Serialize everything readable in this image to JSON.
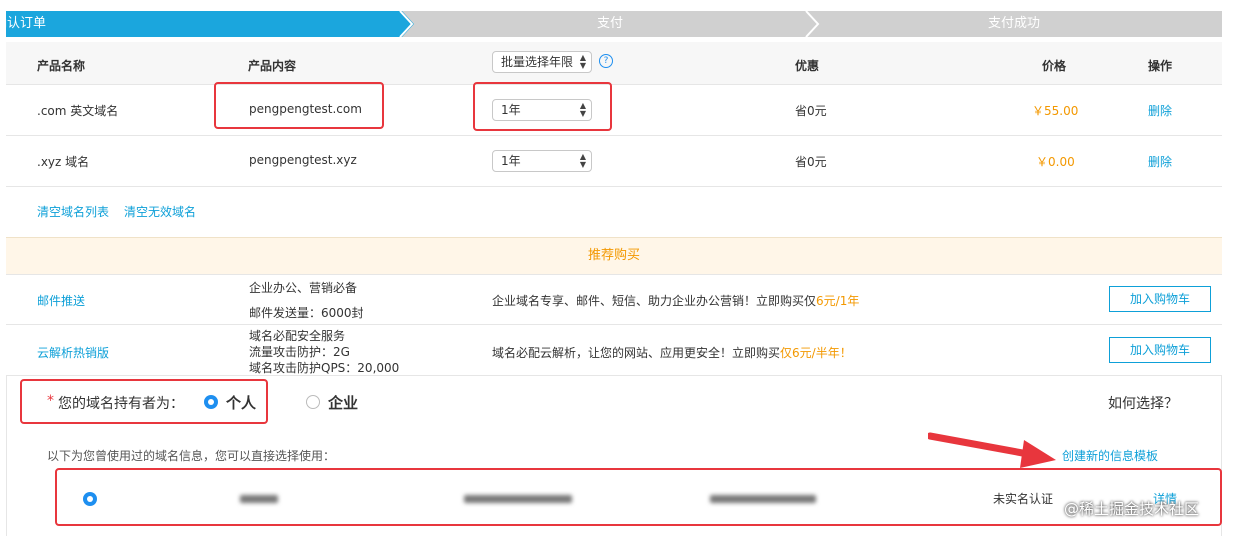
{
  "steps": [
    {
      "label": "确认订单",
      "active": true
    },
    {
      "label": "支付",
      "active": false
    },
    {
      "label": "支付成功",
      "active": false
    }
  ],
  "colors": {
    "step_active": "#1ba6dd",
    "step_inactive": "#d0d0d0",
    "link": "#0ea0d8",
    "price": "#f39800",
    "highlight": "#e8363d",
    "arrow": "#e8363d"
  },
  "table": {
    "headers": {
      "name": "产品名称",
      "content": "产品内容",
      "period_select": "批量选择年限",
      "discount": "优惠",
      "price": "价格",
      "action": "操作"
    },
    "rows": [
      {
        "name": ".com 英文域名",
        "content": "pengpengtest.com",
        "period": "1年",
        "discount": "省0元",
        "price": "￥55.00",
        "action": "删除"
      },
      {
        "name": ".xyz 域名",
        "content": "pengpengtest.xyz",
        "period": "1年",
        "discount": "省0元",
        "price": "￥0.00",
        "action": "删除"
      }
    ]
  },
  "links": {
    "clear_list": "清空域名列表",
    "clear_invalid": "清空无效域名"
  },
  "recommend": {
    "title": "推荐购买",
    "items": [
      {
        "name": "邮件推送",
        "desc_lines": [
          "企业办公、营销必备",
          "邮件发送量：6000封"
        ],
        "promo_text": "企业域名专享、邮件、短信、助力企业办公营销！立即购买仅",
        "promo_highlight": "6元/1年",
        "button": "加入购物车"
      },
      {
        "name": "云解析热销版",
        "desc_lines": [
          "域名必配安全服务",
          "流量攻击防护：2G",
          "域名攻击防护QPS：20,000"
        ],
        "promo_text": "域名必配云解析，让您的网站、应用更安全！立即购买",
        "promo_highlight": "仅6元/半年！",
        "button": "加入购物车"
      }
    ]
  },
  "holder": {
    "required_mark": "*",
    "label": "您的域名持有者为：",
    "options": [
      {
        "label": "个人",
        "selected": true
      },
      {
        "label": "企业",
        "selected": false
      }
    ],
    "help": "如何选择？",
    "hint": "以下为您曾使用过的域名信息，您可以直接选择使用：",
    "create_template": "创建新的信息模板",
    "template": {
      "status": "未实名认证",
      "detail": "详情"
    }
  },
  "watermark": "@稀土掘金技术社区"
}
